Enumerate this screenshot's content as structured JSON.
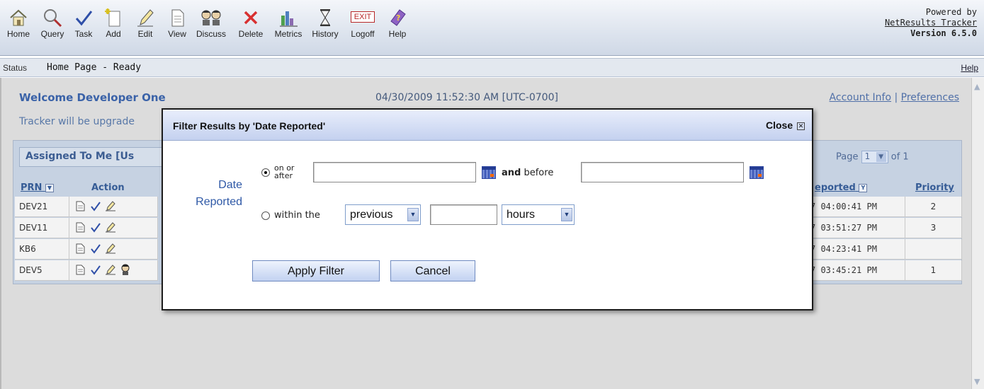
{
  "toolbar": {
    "items": [
      {
        "label": "Home",
        "icon": "house-icon"
      },
      {
        "label": "Query",
        "icon": "magnifier-icon"
      },
      {
        "label": "Task",
        "icon": "checkmark-icon"
      },
      {
        "label": "Add",
        "icon": "add-document-icon"
      },
      {
        "label": "Edit",
        "icon": "pencil-icon"
      },
      {
        "label": "View",
        "icon": "document-icon"
      },
      {
        "label": "Discuss",
        "icon": "people-icon"
      },
      {
        "label": "Delete",
        "icon": "x-icon"
      },
      {
        "label": "Metrics",
        "icon": "bar-chart-icon"
      },
      {
        "label": "History",
        "icon": "hourglass-icon"
      },
      {
        "label": "Logoff",
        "icon": "exit-sign-icon"
      },
      {
        "label": "Help",
        "icon": "help-book-icon"
      }
    ],
    "exit_text": "EXIT",
    "powered_by": "Powered by",
    "product": "NetResults Tracker",
    "version": "Version 6.5.0"
  },
  "statusbar": {
    "label": "Status",
    "text": "Home Page - Ready",
    "help": "Help"
  },
  "home": {
    "welcome": "Welcome Developer One",
    "datetime": "04/30/2009 11:52:30 AM [UTC-0700]",
    "account_info": "Account Info",
    "separator": "|",
    "preferences": "Preferences",
    "upgrade_notice": "Tracker will be upgrade"
  },
  "panel": {
    "title": "Assigned To Me [Us",
    "page_label": "Page",
    "page_value": "1",
    "page_of": "of 1",
    "columns": {
      "prn": "PRN",
      "action": "Action",
      "reported": "eported",
      "priority": "Priority"
    },
    "rows": [
      {
        "prn": "DEV21",
        "reported": "7 04:00:41 PM",
        "priority": "2",
        "discuss": false
      },
      {
        "prn": "DEV11",
        "reported": "7 03:51:27 PM",
        "priority": "3",
        "discuss": false
      },
      {
        "prn": "KB6",
        "reported": "7 04:23:41 PM",
        "priority": "",
        "discuss": false
      },
      {
        "prn": "DEV5",
        "reported": "7 03:45:21 PM",
        "priority": "1",
        "discuss": true
      }
    ]
  },
  "modal": {
    "title": "Filter Results by 'Date Reported'",
    "close": "Close",
    "field_label_line1": "Date",
    "field_label_line2": "Reported",
    "opt1_line1": "on or",
    "opt1_line2": "after",
    "and_word": "and",
    "before_word": "before",
    "opt2_label": "within the",
    "direction": "previous",
    "unit": "hours",
    "on_or_after_value": "",
    "before_value": "",
    "amount_value": "",
    "apply": "Apply Filter",
    "cancel": "Cancel"
  },
  "colors": {
    "accent": "#3a62a8",
    "panel": "#c6d2e2",
    "overlay": "#dcdcdc"
  }
}
